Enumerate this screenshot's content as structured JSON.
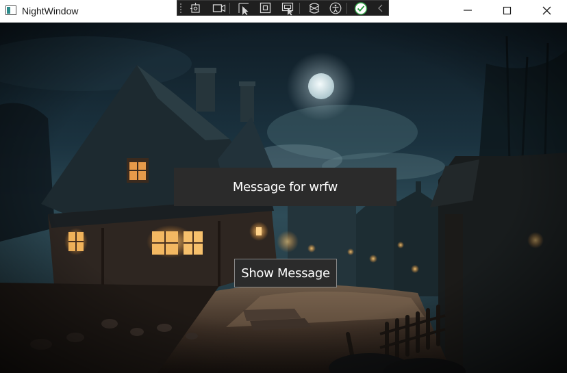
{
  "window": {
    "title": "NightWindow"
  },
  "debug_toolbar": {
    "items": [
      "select-element-icon",
      "track-focus-icon",
      "video-icon",
      "pointer-select-icon",
      "adorner-icon",
      "layout-adorner-icon",
      "hot-reload-icon",
      "accessibility-icon",
      "checkmark-icon",
      "collapse-chevron-icon"
    ]
  },
  "message_panel": {
    "text": "Message for wrfw"
  },
  "show_button": {
    "label": "Show Message"
  },
  "colors": {
    "panel_background": "#2b2b2b",
    "text": "#ffffff",
    "title_bar": "#ffffff",
    "sky": "#0f1f2a",
    "check_green": "#2ea043"
  }
}
